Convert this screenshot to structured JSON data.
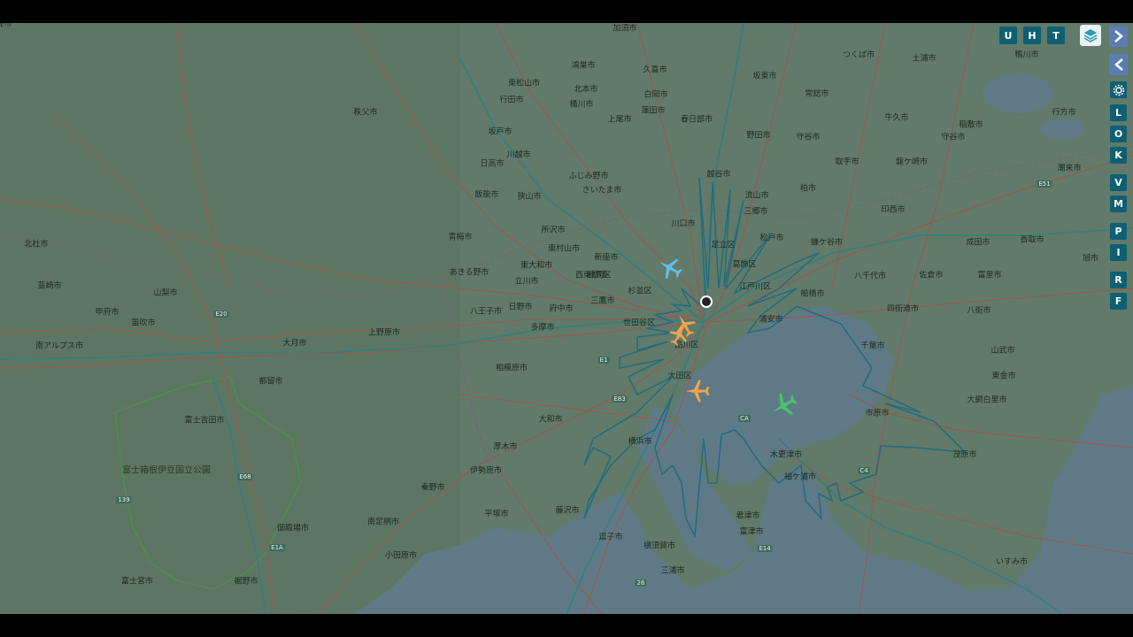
{
  "toolbar": {
    "buttons": [
      "U",
      "H",
      "T"
    ],
    "layers_icon": "layers-icon"
  },
  "sidebar": {
    "arrows": [
      "chevron-right-icon",
      "chevron-left-icon"
    ],
    "settings_icon": "gear-icon",
    "buttons": [
      "L",
      "O",
      "K",
      "V",
      "M",
      "P",
      "I",
      "R",
      "F"
    ]
  },
  "map": {
    "cities": [
      "加須市",
      "つくば市",
      "土浦市",
      "鴻巣市",
      "久喜市",
      "坂東市",
      "東松山市",
      "北本市",
      "白岡市",
      "常総市",
      "守谷市",
      "行田市",
      "桶川市",
      "蓮田市",
      "牛久市",
      "秩父市",
      "上尾市",
      "春日部市",
      "野田市",
      "坂戸市",
      "守谷市",
      "龍ケ崎市",
      "稲敷市",
      "川越市",
      "ふじみ野市",
      "取手市",
      "日高市",
      "さいたま市",
      "越谷市",
      "柏市",
      "飯能市",
      "狭山市",
      "流山市",
      "三郷市",
      "印西市",
      "所沢市",
      "川口市",
      "松戸市",
      "鎌ケ谷市",
      "青梅市",
      "東村山市",
      "新座市",
      "足立区",
      "成田市",
      "東大和市",
      "練馬区",
      "葛飾区",
      "富里市",
      "あきる野市",
      "立川市",
      "西東京市",
      "杉並区",
      "江戸川区",
      "八千代市",
      "佐倉市",
      "三鷹市",
      "船橋市",
      "八王子市",
      "日野市",
      "府中市",
      "世田谷区",
      "浦安市",
      "四街道市",
      "八街市",
      "多摩市",
      "品川区",
      "千葉市",
      "山武市",
      "相模原市",
      "大田区",
      "東金市",
      "大和市",
      "市原市",
      "大網白里市",
      "厚木市",
      "横浜市",
      "木更津市",
      "茂原市",
      "袖ケ浦市",
      "伊勢原市",
      "秦野市",
      "平塚市",
      "藤沢市",
      "君津市",
      "逗子市",
      "南足柄市",
      "富津市",
      "横須賀市",
      "三浦市",
      "いすみ市",
      "小田原市",
      "北杜市",
      "韮崎市",
      "甲府市",
      "山梨市",
      "笛吹市",
      "南アルプス市",
      "大月市",
      "上野原市",
      "都留市",
      "富士吉田市",
      "御殿場市",
      "富士宮市",
      "裾野市",
      "鴨川市",
      "行方市",
      "潮来市",
      "香取市",
      "旭市",
      "匝瑳市"
    ],
    "highways": [
      "E20",
      "E68",
      "E1",
      "E1A",
      "E83",
      "C4",
      "CA",
      "E14",
      "E51",
      "139",
      "26"
    ],
    "parks": [
      "富士箱根伊豆国立公園"
    ],
    "map_numbers": [
      "11",
      "139",
      "26"
    ],
    "ground_station_icon": "station-marker-icon"
  },
  "aircraft": [
    {
      "name": "aircraft-blue",
      "color": "#5bc0eb"
    },
    {
      "name": "aircraft-orange-1",
      "color": "#f0a24a"
    },
    {
      "name": "aircraft-orange-2",
      "color": "#f0a24a"
    },
    {
      "name": "aircraft-orange-3",
      "color": "#f0a24a"
    },
    {
      "name": "aircraft-green",
      "color": "#4cc26a"
    }
  ],
  "colors": {
    "range_outline": "#1f6b80",
    "toolbar_button": "#0f5f72",
    "arrow_button": "#5b7cb3",
    "sea": "#5f7a86",
    "land": "#5f7868"
  }
}
